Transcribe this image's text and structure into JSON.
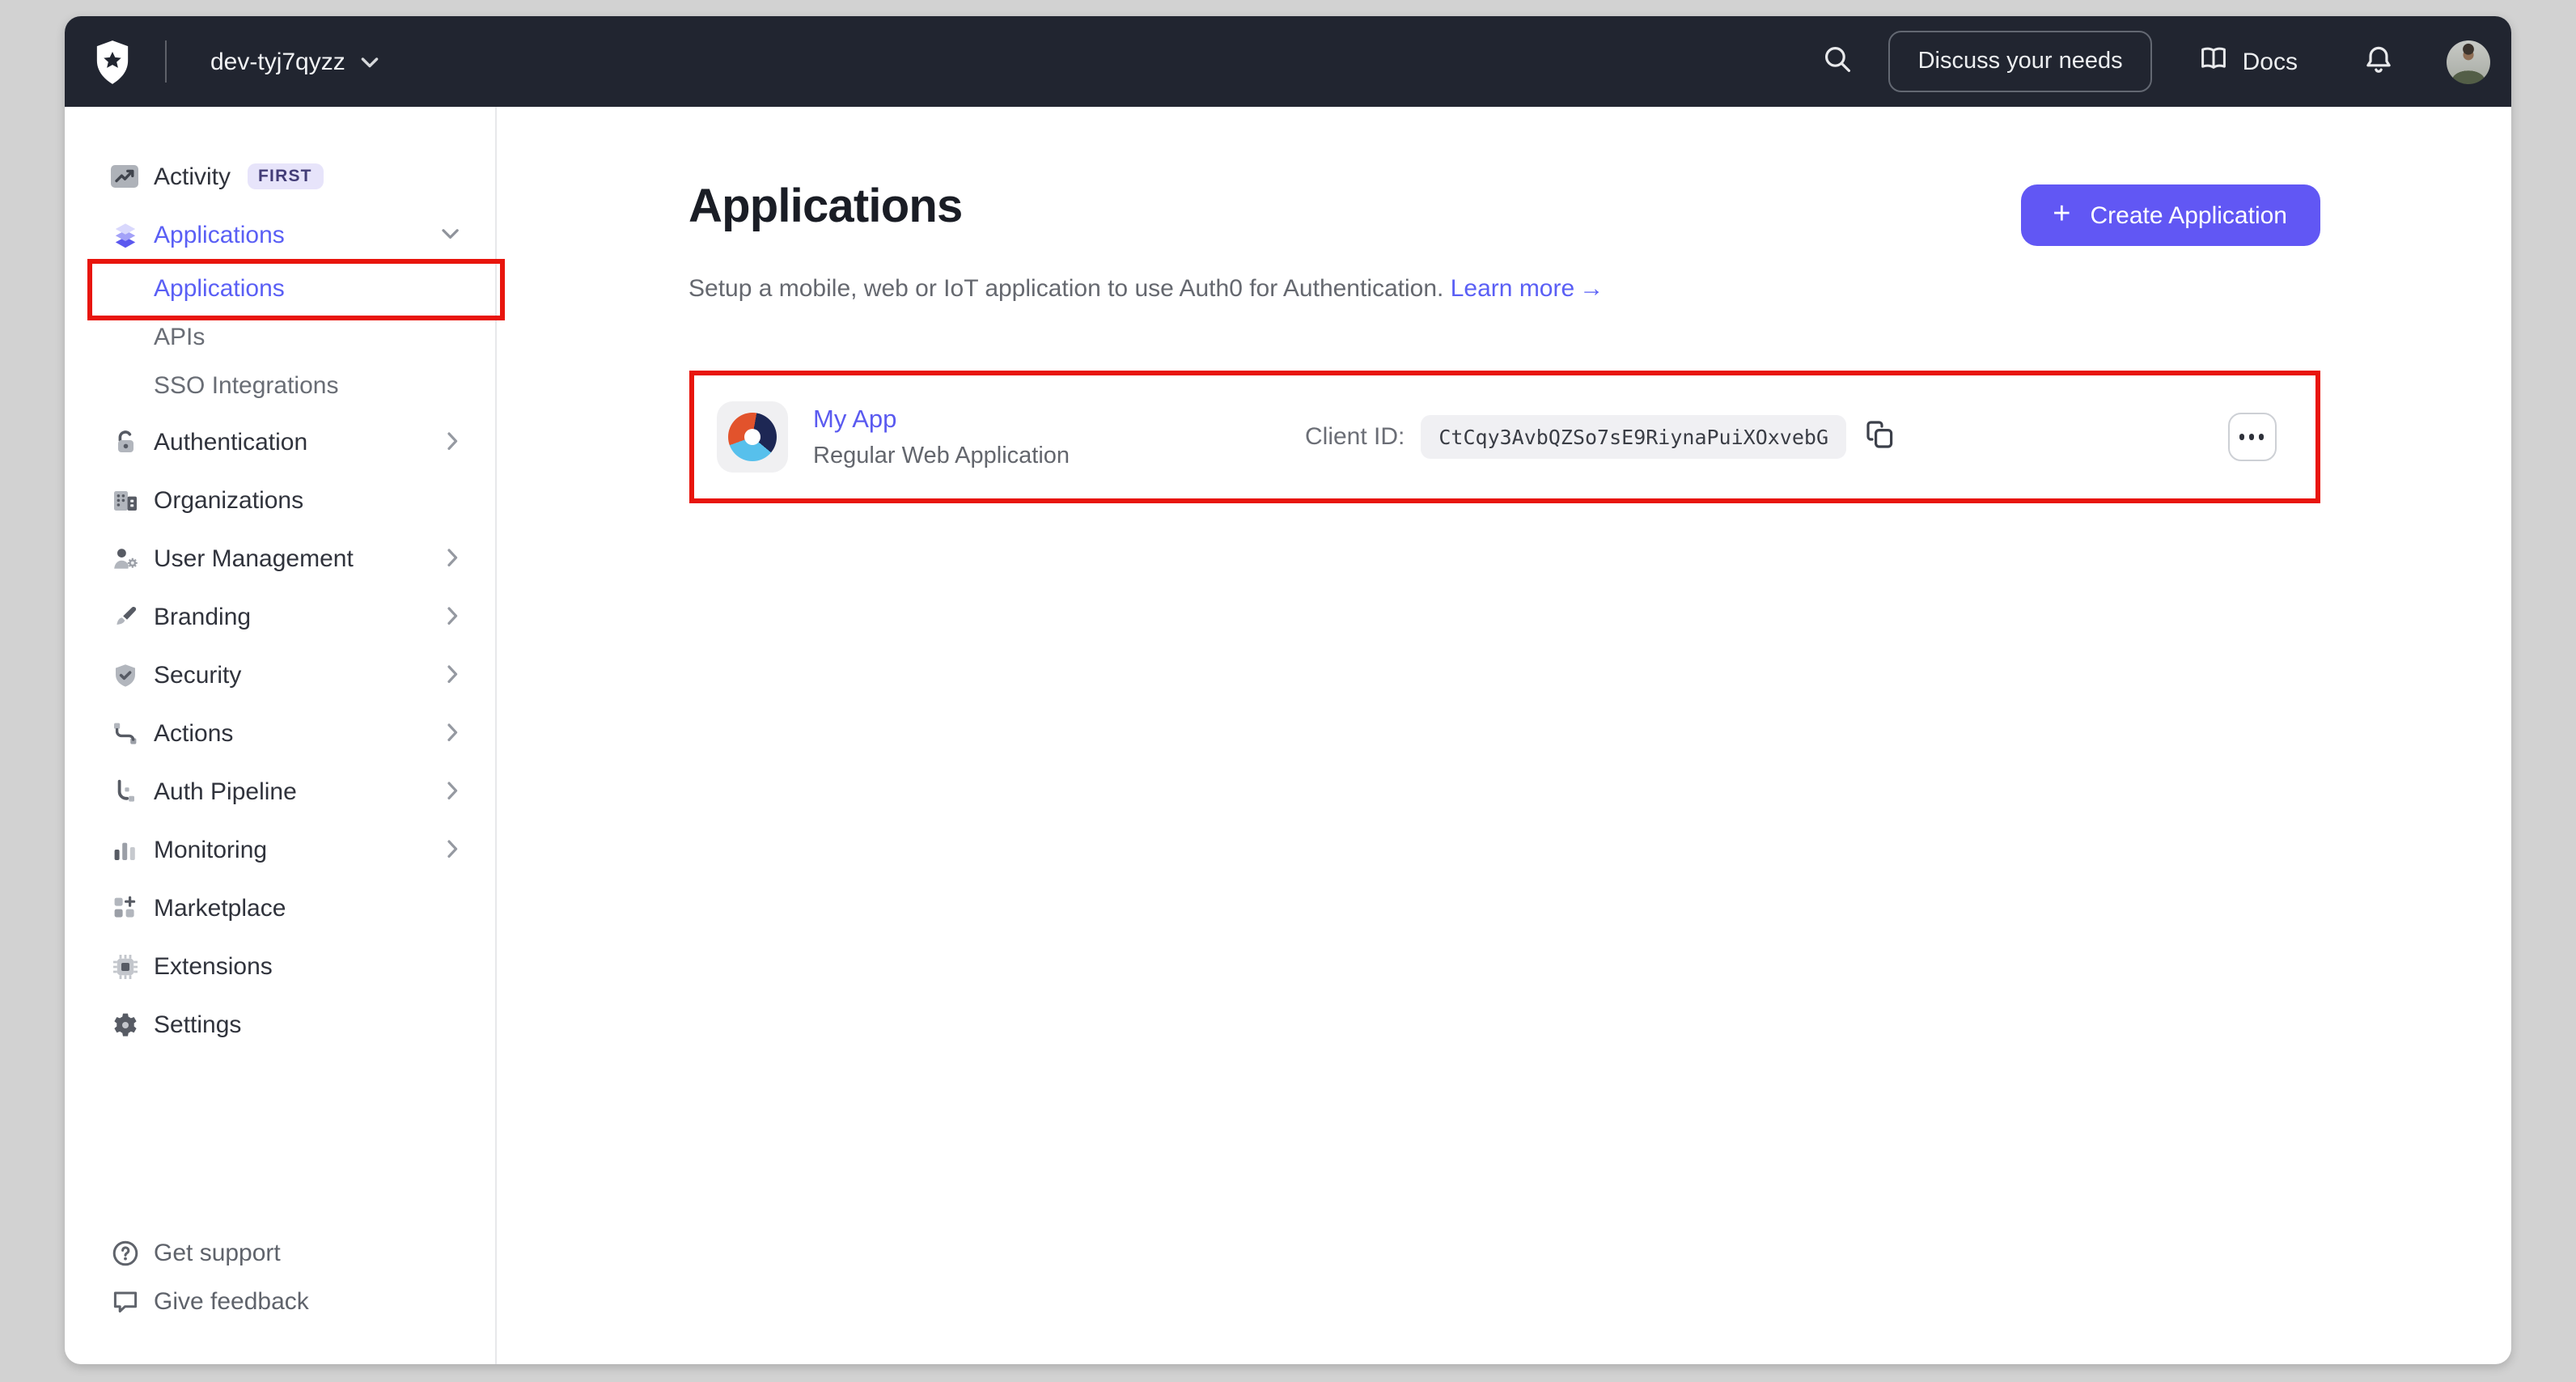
{
  "window": {
    "frame_color": "#d2d2d2",
    "page_bg": "#ffffff"
  },
  "topbar": {
    "tenant_name": "dev-tyj7qyzz",
    "discuss_button_label": "Discuss your needs",
    "docs_label": "Docs"
  },
  "sidebar": {
    "items": [
      {
        "label": "Activity",
        "badge": "FIRST",
        "chevron": null
      },
      {
        "label": "Applications",
        "chevron": "down",
        "active": true
      },
      {
        "label": "Authentication",
        "chevron": "right"
      },
      {
        "label": "Organizations",
        "chevron": null
      },
      {
        "label": "User Management",
        "chevron": "right"
      },
      {
        "label": "Branding",
        "chevron": "right"
      },
      {
        "label": "Security",
        "chevron": "right"
      },
      {
        "label": "Actions",
        "chevron": "right"
      },
      {
        "label": "Auth Pipeline",
        "chevron": "right"
      },
      {
        "label": "Monitoring",
        "chevron": "right"
      },
      {
        "label": "Marketplace",
        "chevron": null
      },
      {
        "label": "Extensions",
        "chevron": null
      },
      {
        "label": "Settings",
        "chevron": null
      }
    ],
    "applications_subitems": [
      {
        "label": "Applications",
        "active": true,
        "annotated": true
      },
      {
        "label": "APIs",
        "active": false
      },
      {
        "label": "SSO Integrations",
        "active": false
      }
    ],
    "footer_items": [
      {
        "label": "Get support"
      },
      {
        "label": "Give feedback"
      }
    ]
  },
  "main": {
    "page_title": "Applications",
    "subtitle": "Setup a mobile, web or IoT application to use Auth0 for Authentication.",
    "learn_more_label": "Learn more",
    "learn_more_arrow": "→",
    "create_button_plus": "+",
    "create_button_label": "Create Application",
    "application": {
      "name": "My App",
      "type": "Regular Web Application",
      "client_id_label": "Client ID:",
      "client_id": "CtCqy3AvbQZSo7sE9RiynaPuiXOxvebG"
    }
  },
  "annotations": {
    "highlight_color": "#e8150d",
    "targets": [
      "sidebar-applications-subitem",
      "application-row"
    ]
  },
  "colors": {
    "accent": "#635dff",
    "topbar_bg": "#212530",
    "badge_bg": "#e7e4fa",
    "badge_text": "#433d77",
    "active_link": "#5a5ff5",
    "create_button_bg": "#6157f4",
    "client_pill_bg": "#f0f0f3",
    "app_logo_orange": "#e2532c",
    "app_logo_navy": "#1d2754",
    "app_logo_blue": "#57c0ec"
  },
  "icons": {
    "topbar": [
      "auth0-logo",
      "chevron-down-icon",
      "search-icon",
      "book-icon",
      "bell-icon",
      "avatar"
    ],
    "sidebar": [
      "activity-icon",
      "applications-layers-icon",
      "lock-icon",
      "building-icon",
      "user-gear-icon",
      "paintbrush-icon",
      "shield-check-icon",
      "actions-flow-icon",
      "pipeline-icon",
      "bar-chart-icon",
      "grid-plus-icon",
      "chip-icon",
      "gear-icon",
      "help-circle-icon",
      "speech-bubble-icon"
    ],
    "row": [
      "app-logo-donut",
      "copy-icon",
      "more-dots-icon"
    ]
  }
}
